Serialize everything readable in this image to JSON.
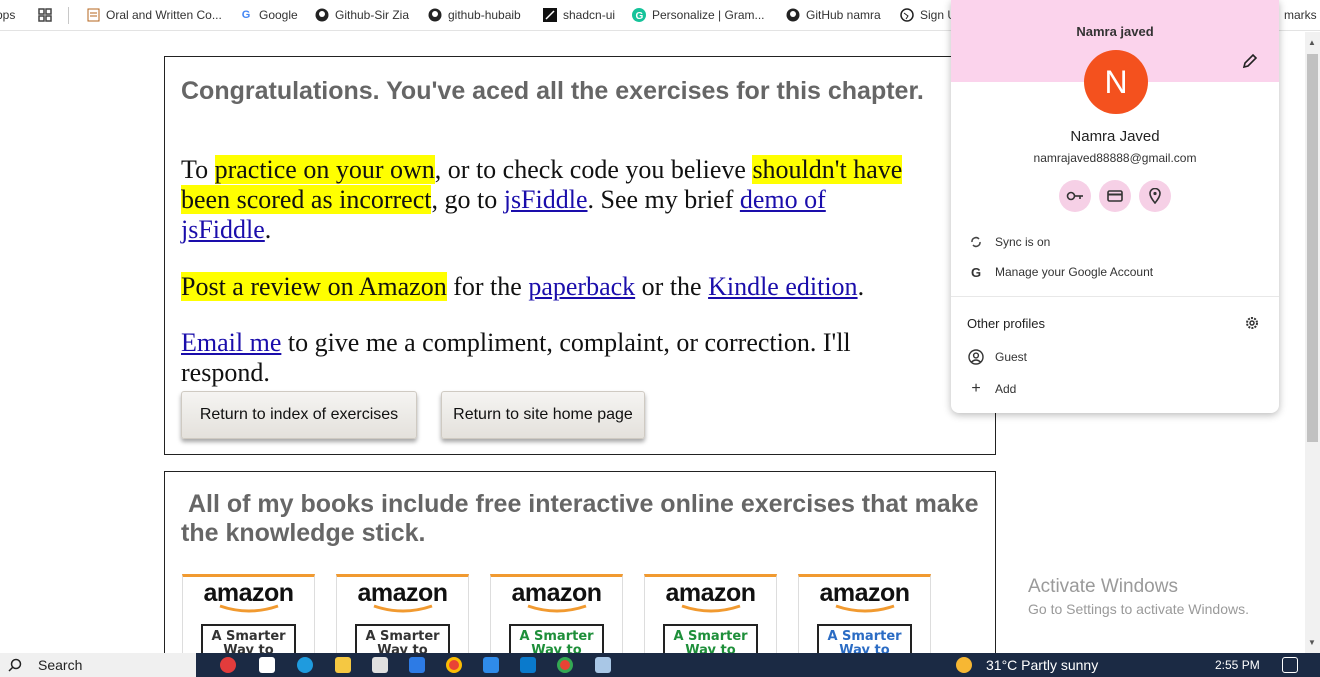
{
  "bookmarks": {
    "apps_label": "Apps",
    "items": [
      {
        "label": "Oral and Written Co...",
        "icon": "document-icon"
      },
      {
        "label": "Google",
        "icon": "google-icon"
      },
      {
        "label": "Github-Sir Zia",
        "icon": "github-icon"
      },
      {
        "label": "github-hubaib",
        "icon": "github-icon"
      },
      {
        "label": "shadcn-ui",
        "icon": "shadcn-icon"
      },
      {
        "label": "Personalize | Gram...",
        "icon": "grammarly-icon"
      },
      {
        "label": "GitHub namra",
        "icon": "github-icon"
      },
      {
        "label": "Sign U",
        "icon": "globe-icon"
      }
    ],
    "overflow_label": "marks"
  },
  "content": {
    "congrats": "Congratulations. You've aced all the exercises for this chapter.",
    "p1": {
      "t1": "To ",
      "h1": "practice on your own",
      "t2": ", or to check code you believe ",
      "h2": "shouldn't have",
      "h3": "been scored as incorrect",
      "t3": ", go to ",
      "l1": "jsFiddle",
      "t4": ". See my brief ",
      "l2a": "demo of",
      "l2b": "jsFiddle",
      "t5": "."
    },
    "p2": {
      "h1": "Post a review on Amazon",
      "t1": " for the ",
      "l1": "paperback",
      "t2": " or the ",
      "l2": "Kindle edition",
      "t3": "."
    },
    "p3": {
      "l1": "Email me",
      "t1": " to give me a compliment, complaint, or correction. I'll respond."
    },
    "buttons": {
      "return_index": "Return to index of exercises",
      "return_home": "Return to site home page"
    },
    "books_heading": "All of my books include free interactive online exercises that make the knowledge stick.",
    "books": [
      {
        "brand": "amazon",
        "cover_text": "A Smarter Way to Learn",
        "color": "#333333"
      },
      {
        "brand": "amazon",
        "cover_text": "A Smarter Way to Learn",
        "color": "#333333"
      },
      {
        "brand": "amazon",
        "cover_text": "A Smarter Way to",
        "color": "#1e8f3a"
      },
      {
        "brand": "amazon",
        "cover_text": "A Smarter Way to",
        "color": "#1e8f3a"
      },
      {
        "brand": "amazon",
        "cover_text": "A Smarter Way to",
        "color": "#2b6cc4"
      }
    ]
  },
  "profile": {
    "name_header": "Namra javed",
    "avatar_letter": "N",
    "full_name": "Namra Javed",
    "email": "namrajaved88888@gmail.com",
    "sync": "Sync is on",
    "manage": "Manage your Google Account",
    "other_profiles": "Other profiles",
    "guest": "Guest",
    "add": "Add",
    "accent": "#f4511e",
    "band_color": "#fbd3ec"
  },
  "windows": {
    "activate_title": "Activate Windows",
    "activate_sub": "Go to Settings to activate Windows."
  },
  "taskbar": {
    "search": "Search",
    "weather": "31°C  Partly sunny",
    "time": "2:55 PM"
  }
}
